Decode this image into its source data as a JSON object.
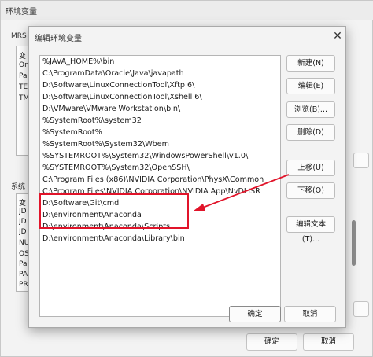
{
  "parent_window": {
    "title": "环境变量",
    "user_section_label": "MRS",
    "system_section_label": "系统",
    "user_rows": [
      "变",
      "On",
      "Pa",
      "TE",
      "TM"
    ],
    "system_rows": [
      "变",
      "JD",
      "JD",
      "JD",
      "NU",
      "OS",
      "Pa",
      "PA",
      "PR"
    ],
    "ok_label": "确定",
    "cancel_label": "取消"
  },
  "dialog": {
    "title": "编辑环境变量",
    "close_glyph": "✕",
    "path_entries": [
      "%JAVA_HOME%\\bin",
      "C:\\ProgramData\\Oracle\\Java\\javapath",
      "D:\\Software\\LinuxConnectionTool\\Xftp 6\\",
      "D:\\Software\\LinuxConnectionTool\\Xshell 6\\",
      "D:\\VMware\\VMware Workstation\\bin\\",
      "%SystemRoot%\\system32",
      "%SystemRoot%",
      "%SystemRoot%\\System32\\Wbem",
      "%SYSTEMROOT%\\System32\\WindowsPowerShell\\v1.0\\",
      "%SYSTEMROOT%\\System32\\OpenSSH\\",
      "C:\\Program Files (x86)\\NVIDIA Corporation\\PhysX\\Common",
      "C:\\Program Files\\NVIDIA Corporation\\NVIDIA App\\NvDLISR",
      "D:\\Software\\Git\\cmd",
      "D:\\environment\\Anaconda",
      "D:\\environment\\Anaconda\\Scripts",
      "D:\\environment\\Anaconda\\Library\\bin"
    ],
    "buttons": {
      "new": "新建(N)",
      "edit": "编辑(E)",
      "browse": "浏览(B)...",
      "delete": "删除(D)",
      "move_up": "上移(U)",
      "move_down": "下移(O)",
      "edit_text": "编辑文本(T)...",
      "ok": "确定",
      "cancel": "取消"
    }
  },
  "annotation_color": "#e1142a"
}
